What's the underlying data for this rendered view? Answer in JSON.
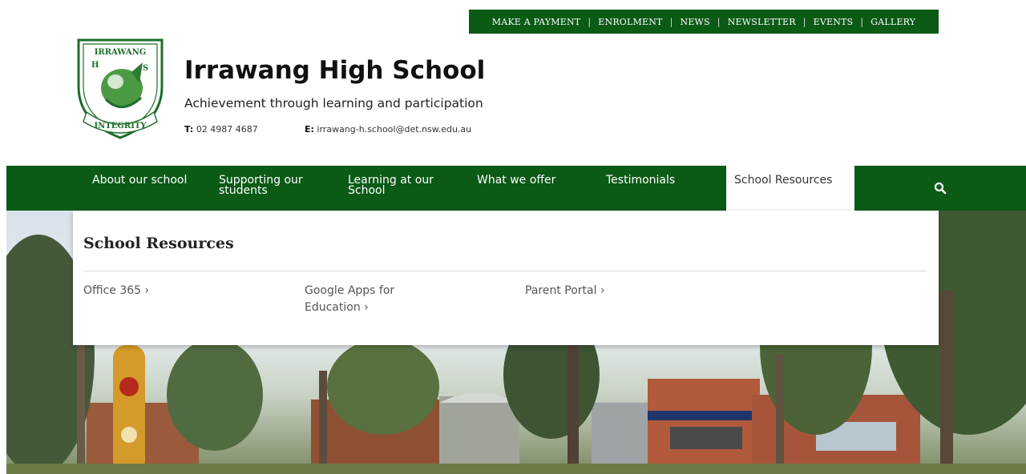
{
  "utility_nav": {
    "items": [
      "MAKE A PAYMENT",
      "ENROLMENT",
      "NEWS",
      "NEWSLETTER",
      "EVENTS",
      "GALLERY"
    ],
    "separator": "|"
  },
  "logo": {
    "top_text": "IRRAWANG",
    "letter_h": "H",
    "letter_s": "S",
    "bottom_text": "INTEGRITY"
  },
  "header": {
    "school_name": "Irrawang High School",
    "tagline": "Achievement through learning and participation",
    "phone_label": "T:",
    "phone": "02 4987 4687",
    "email_label": "E:",
    "email": "irrawang-h.school@det.nsw.edu.au"
  },
  "main_nav": {
    "items": [
      {
        "line1": "About our school",
        "line2": ""
      },
      {
        "line1": "Supporting our",
        "line2": "students"
      },
      {
        "line1": "Learning at our",
        "line2": "School"
      },
      {
        "line1": "What we offer",
        "line2": ""
      },
      {
        "line1": "Testimonials",
        "line2": ""
      },
      {
        "line1": "School Resources",
        "line2": ""
      }
    ],
    "search_icon": "search-icon"
  },
  "dropdown": {
    "title": "School Resources",
    "links": [
      {
        "line1": "Office 365 ›",
        "line2": ""
      },
      {
        "line1": "Google Apps for",
        "line2": "Education ›"
      },
      {
        "line1": "Parent Portal ›",
        "line2": ""
      }
    ]
  },
  "colors": {
    "brand_green": "#0b5a16",
    "white": "#ffffff"
  }
}
